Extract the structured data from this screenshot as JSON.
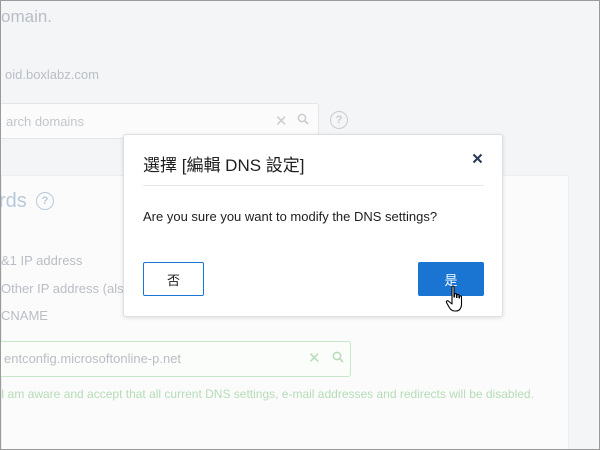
{
  "background": {
    "title": "omain.",
    "domain": "oid.boxlabz.com",
    "search_placeholder": "arch domains",
    "records_heading": "rds",
    "options": [
      "&1 IP address",
      "Other IP address (also",
      "CNAME"
    ],
    "cname_value": "entconfig.microsoftonline-p.net",
    "warning": "I am aware and accept that all current DNS settings, e-mail addresses and redirects will be disabled."
  },
  "dialog": {
    "title": "選擇 [編輯 DNS 設定]",
    "message": "Are you sure you want to modify the DNS settings?",
    "no_label": "否",
    "yes_label": "是"
  },
  "icons": {
    "close": "close-icon",
    "help": "help-circle-icon",
    "search": "search-icon",
    "clear": "clear-icon",
    "cursor": "hand-pointer-icon"
  },
  "colors": {
    "primary": "#1a74d1",
    "valid": "#b5dcb6"
  }
}
